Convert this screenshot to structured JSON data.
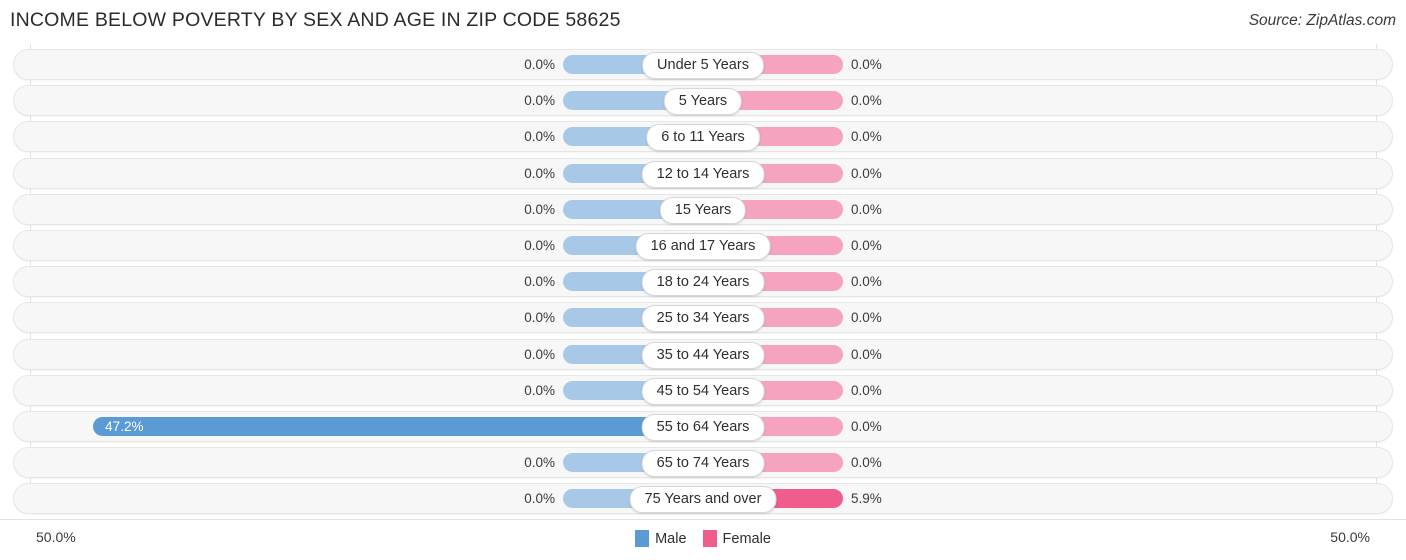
{
  "header": {
    "title": "INCOME BELOW POVERTY BY SEX AND AGE IN ZIP CODE 58625",
    "source": "Source: ZipAtlas.com"
  },
  "legend": {
    "male_label": "Male",
    "female_label": "Female",
    "male_color": "#5b9bd5",
    "female_color": "#ee5d8c"
  },
  "axis": {
    "left_label": "50.0%",
    "right_label": "50.0%"
  },
  "colors": {
    "male_zero": "#a8c8e8",
    "female_zero": "#f5a3be",
    "male_active": "#5b9bd5",
    "female_active": "#ee5d8c",
    "track": "#f7f7f7"
  },
  "chart_data": {
    "type": "bar",
    "title": "INCOME BELOW POVERTY BY SEX AND AGE IN ZIP CODE 58625",
    "subtitle": "Source: ZipAtlas.com",
    "orientation": "horizontal-diverging",
    "xlabel": "",
    "ylabel": "",
    "xlim": [
      -50.0,
      50.0
    ],
    "axis_left_label": "50.0%",
    "axis_right_label": "50.0%",
    "grid": false,
    "legend_position": "bottom-center",
    "categories": [
      "Under 5 Years",
      "5 Years",
      "6 to 11 Years",
      "12 to 14 Years",
      "15 Years",
      "16 and 17 Years",
      "18 to 24 Years",
      "25 to 34 Years",
      "35 to 44 Years",
      "45 to 54 Years",
      "55 to 64 Years",
      "65 to 74 Years",
      "75 Years and over"
    ],
    "series": [
      {
        "name": "Male",
        "side": "left",
        "values": [
          0.0,
          0.0,
          0.0,
          0.0,
          0.0,
          0.0,
          0.0,
          0.0,
          0.0,
          0.0,
          47.2,
          0.0,
          0.0
        ],
        "labels": [
          "0.0%",
          "0.0%",
          "0.0%",
          "0.0%",
          "0.0%",
          "0.0%",
          "0.0%",
          "0.0%",
          "0.0%",
          "0.0%",
          "47.2%",
          "0.0%",
          "0.0%"
        ]
      },
      {
        "name": "Female",
        "side": "right",
        "values": [
          0.0,
          0.0,
          0.0,
          0.0,
          0.0,
          0.0,
          0.0,
          0.0,
          0.0,
          0.0,
          0.0,
          0.0,
          5.9
        ],
        "labels": [
          "0.0%",
          "0.0%",
          "0.0%",
          "0.0%",
          "0.0%",
          "0.0%",
          "0.0%",
          "0.0%",
          "0.0%",
          "0.0%",
          "0.0%",
          "0.0%",
          "5.9%"
        ]
      }
    ]
  }
}
